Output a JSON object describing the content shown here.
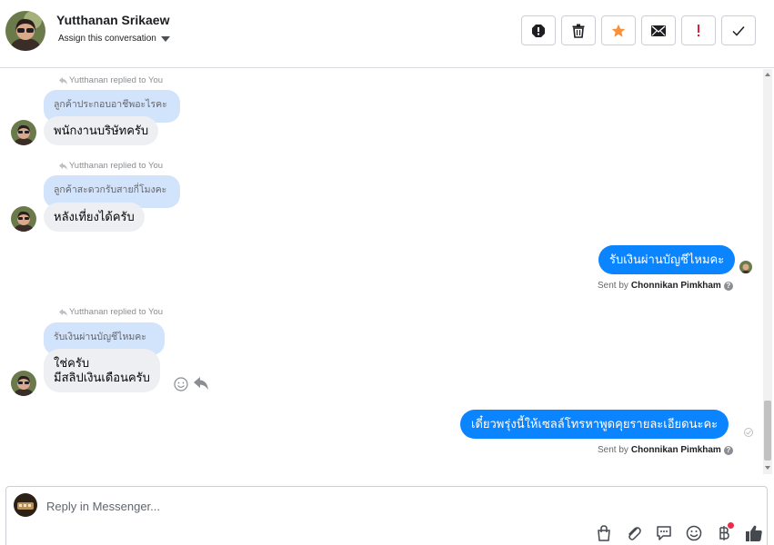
{
  "header": {
    "name": "Yutthanan Srikaew",
    "assign_label": "Assign this conversation",
    "actions": [
      {
        "name": "spam-icon",
        "label": "Mark as spam"
      },
      {
        "name": "trash-icon",
        "label": "Delete"
      },
      {
        "name": "star-icon",
        "label": "Star"
      },
      {
        "name": "envelope-icon",
        "label": "Mark as unread"
      },
      {
        "name": "exclamation-icon",
        "label": "Follow up"
      },
      {
        "name": "check-icon",
        "label": "Mark as done"
      }
    ]
  },
  "messages": [
    {
      "replied_label": "Yutthanan replied to You",
      "quoted": "ลูกค้าประกอบอาชีพอะไรคะ",
      "text": "พนักงานบริษัทครับ"
    },
    {
      "replied_label": "Yutthanan replied to You",
      "quoted": "ลูกค้าสะดวกรับสายกี่โมงคะ",
      "text": "หลังเที่ยงได้ครับ"
    },
    {
      "outgoing": true,
      "text": "รับเงินผ่านบัญชีไหมคะ",
      "sent_by_prefix": "Sent by",
      "sent_by_name": "Chonnikan Pimkham"
    },
    {
      "replied_label": "Yutthanan replied to You",
      "quoted": "รับเงินผ่านบัญชีไหมคะ",
      "text_line1": "ใช่ครับ",
      "text_line2": "มีสลิปเงินเดือนครับ"
    },
    {
      "outgoing": true,
      "text": "เดี๋ยวพรุ่งนี้ให้เซลล์โทรหาพูดคุยรายละเอียดนะคะ",
      "sent_by_prefix": "Sent by",
      "sent_by_name": "Chonnikan Pimkham"
    }
  ],
  "composer": {
    "placeholder": "Reply in Messenger..."
  },
  "colors": {
    "outgoing_bubble": "#0a84ff",
    "incoming_bubble": "#eeeff2",
    "quoted_bubble": "#d2e3fc",
    "star": "#f7923a",
    "exclamation": "#e41e3f",
    "notification_dot": "#f02849"
  }
}
